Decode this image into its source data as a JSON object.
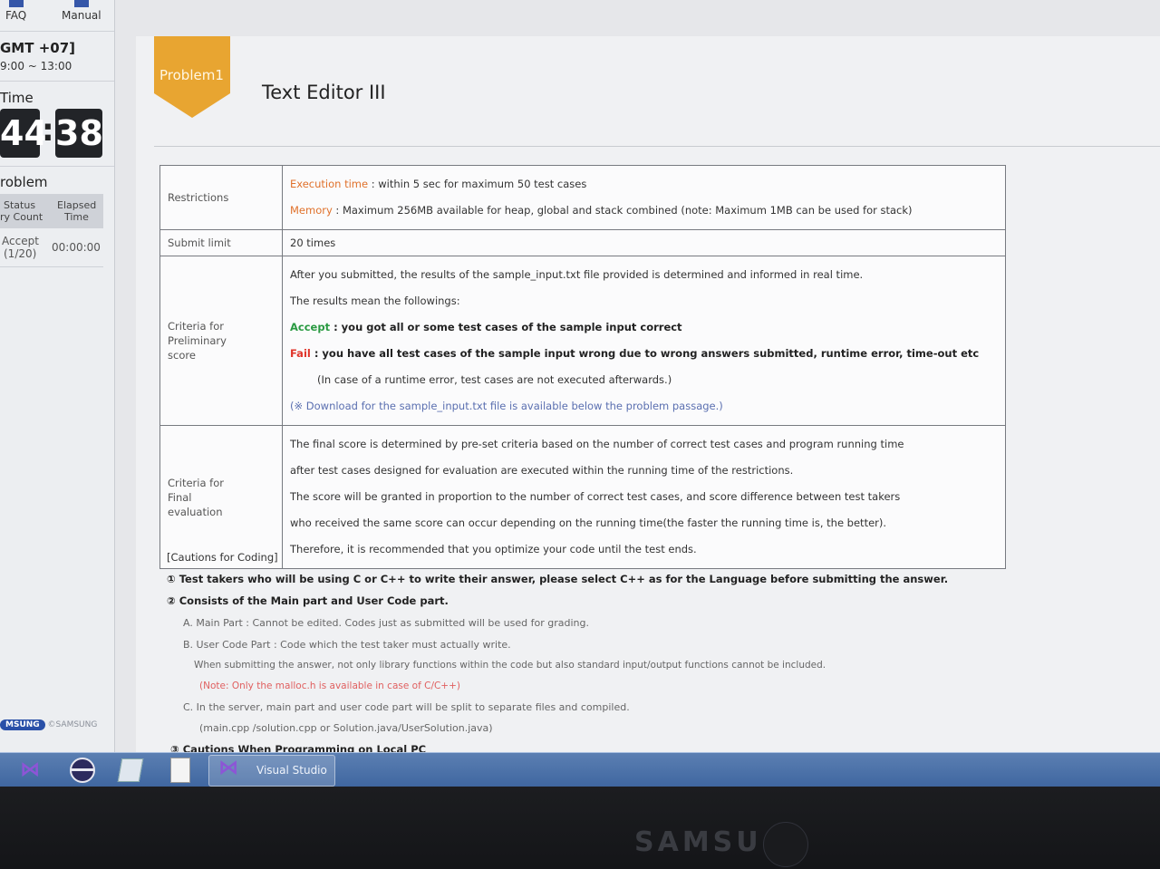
{
  "sidebar": {
    "faq_label": "FAQ",
    "manual_label": "Manual",
    "timezone": "GMT +07]",
    "time_range": "9:00 ~ 13:00",
    "time_label": "Time",
    "timer_minutes": "44",
    "timer_seconds": "38",
    "problem_label": "roblem",
    "status_header": "Status",
    "try_count_header": "ry Count",
    "elapsed_header": "Elapsed",
    "elapsed_header_2": "Time",
    "accept_status": "Accept",
    "accept_count": "(1/20)",
    "elapsed_value": "00:00:00",
    "brand_logo": "MSUNG",
    "brand_copyright": "©SAMSUNG"
  },
  "problem": {
    "badge": "Problem1",
    "title": "Text Editor III"
  },
  "table": {
    "restrictions_label": "Restrictions",
    "execution_time_key": "Execution time",
    "execution_time_value": " : within 5 sec for maximum 50 test cases",
    "memory_key": "Memory",
    "memory_value": " : Maximum 256MB available for heap, global and stack combined (note: Maximum 1MB can be used for stack)",
    "submit_limit_label": "Submit limit",
    "submit_limit_value": "20 times",
    "preliminary_label_1": "Criteria for",
    "preliminary_label_2": "Preliminary",
    "preliminary_label_3": "score",
    "preliminary_line_1": "After you submitted, the results of the sample_input.txt file provided is determined and informed in real time.",
    "preliminary_line_2": "The results mean the followings:",
    "accept_key": "Accept",
    "accept_value": " : you got all or some test cases of the sample input correct",
    "fail_key": "Fail",
    "fail_value": " : you have all test cases of the sample input wrong due to wrong answers submitted, runtime error, time-out etc",
    "runtime_note": "(In case of a runtime error, test cases are not executed afterwards.)",
    "download_note": "(※ Download for the sample_input.txt file is available below the problem passage.)",
    "final_label_1": "Criteria for",
    "final_label_2": "Final",
    "final_label_3": "evaluation",
    "final_line_1": "The final score is determined by pre-set criteria based on the number of correct test cases and program running time",
    "final_line_2": "after test cases designed for evaluation are executed within the running time of the restrictions.",
    "final_line_3": "The score will be granted in proportion to the number of correct test cases, and score difference between test takers",
    "final_line_4": "who received the same score can occur depending on the running time(the faster the running time is, the better).",
    "final_line_5": "Therefore, it is recommended that you optimize your code until the test ends."
  },
  "cautions": {
    "title": "[Cautions for Coding]",
    "item_1": "① Test takers who will be using C or C++ to write their answer, please select C++ as for the Language before submitting the answer.",
    "item_2": "② Consists of the Main part and User Code part.",
    "item_a": "A. Main Part : Cannot be edited. Codes just as submitted will be used for grading.",
    "item_b": "B. User Code Part : Code which the test taker must actually write.",
    "item_b_note": "When submitting the answer, not only library functions within the code but also standard input/output functions cannot be included.",
    "item_b_red": "(Note: Only the malloc.h is available in case of C/C++)",
    "item_c": "C. In the server, main part and user code part will be split to separate files and compiled.",
    "item_c_note": "(main.cpp /solution.cpp or Solution.java/UserSolution.java)",
    "item_3_partial": "③ Cautions When Programming on Local PC"
  },
  "taskbar": {
    "active_window": "Visual Studio"
  },
  "monitor": {
    "brand": "SAMSU"
  }
}
